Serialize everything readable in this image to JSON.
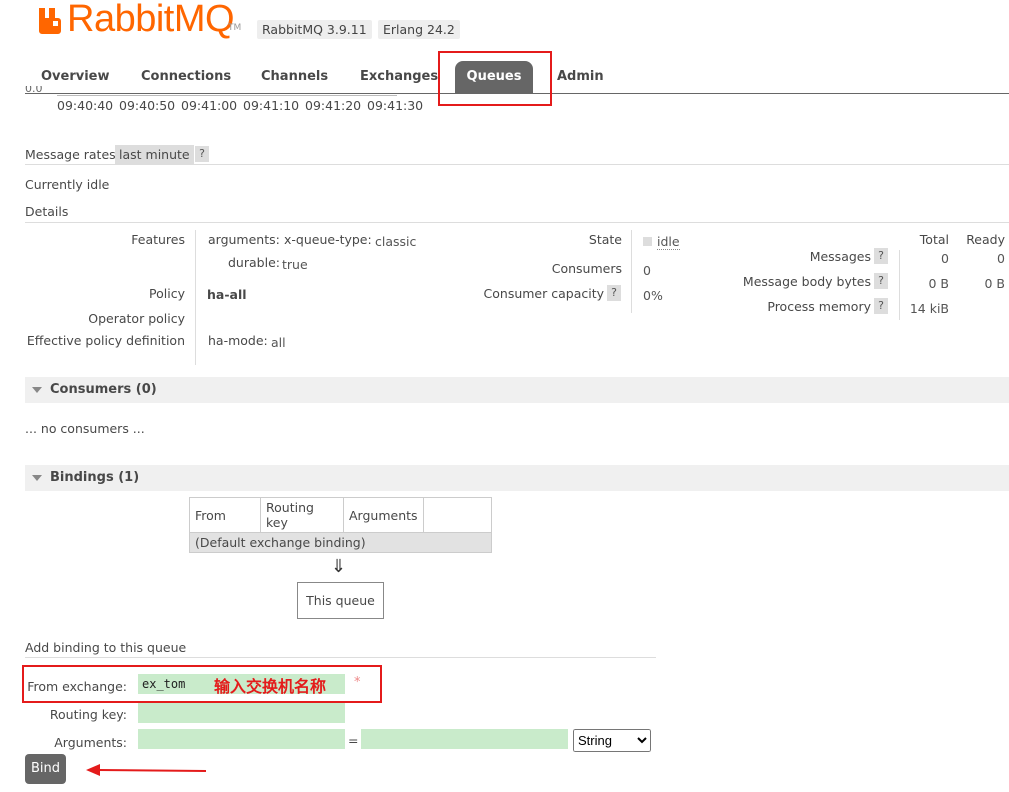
{
  "header": {
    "logo_text": "RabbitMQ",
    "logo_tm": "TM",
    "version": "RabbitMQ 3.9.11",
    "erlang": "Erlang 24.2"
  },
  "nav": {
    "tabs": [
      "Overview",
      "Connections",
      "Channels",
      "Exchanges",
      "Queues",
      "Admin"
    ],
    "active": "Queues"
  },
  "chart": {
    "y_tick_cut": "0.0",
    "x_ticks": [
      "09:40:40",
      "09:40:50",
      "09:41:00",
      "09:41:10",
      "09:41:20",
      "09:41:30"
    ]
  },
  "message_rates": {
    "label": "Message rates",
    "range": "last minute",
    "help": "?"
  },
  "status": "Currently idle",
  "details": {
    "title": "Details",
    "features_label": "Features",
    "arguments_key": "arguments:",
    "arguments_sub_key": "x-queue-type:",
    "arguments_sub_val": "classic",
    "durable_key": "durable:",
    "durable_val": "true",
    "policy_label": "Policy",
    "policy_val": "ha-all",
    "operator_policy_label": "Operator policy",
    "effective_label": "Effective policy definition",
    "effective_key": "ha-mode:",
    "effective_val": "all",
    "state_label": "State",
    "state_val": "idle",
    "consumers_label": "Consumers",
    "consumers_val": "0",
    "capacity_label": "Consumer capacity",
    "capacity_val": "0%",
    "stats_headers": [
      "Total",
      "Ready"
    ],
    "messages_label": "Messages",
    "messages_total": "0",
    "messages_ready": "0",
    "body_label": "Message body bytes",
    "body_total": "0 B",
    "body_ready": "0 B",
    "memory_label": "Process memory",
    "memory_val": "14 kiB",
    "help": "?"
  },
  "consumers_section": {
    "title": "Consumers (0)",
    "empty": "... no consumers ..."
  },
  "bindings_section": {
    "title": "Bindings (1)",
    "columns": [
      "From",
      "Routing key",
      "Arguments"
    ],
    "row": "(Default exchange binding)",
    "arrow": "⇓",
    "this_queue": "This queue"
  },
  "add_binding": {
    "title": "Add binding to this queue",
    "from_label": "From exchange:",
    "from_value": "ex_tom",
    "annotation": "输入交换机名称",
    "required": "*",
    "routing_label": "Routing key:",
    "arguments_label": "Arguments:",
    "equals": "=",
    "type_selected": "String",
    "bind_button": "Bind"
  },
  "colors": {
    "brand": "#ff6600",
    "tab_active": "#666666",
    "input_bg": "#c9ebcb",
    "annotation": "#e41b1b"
  }
}
